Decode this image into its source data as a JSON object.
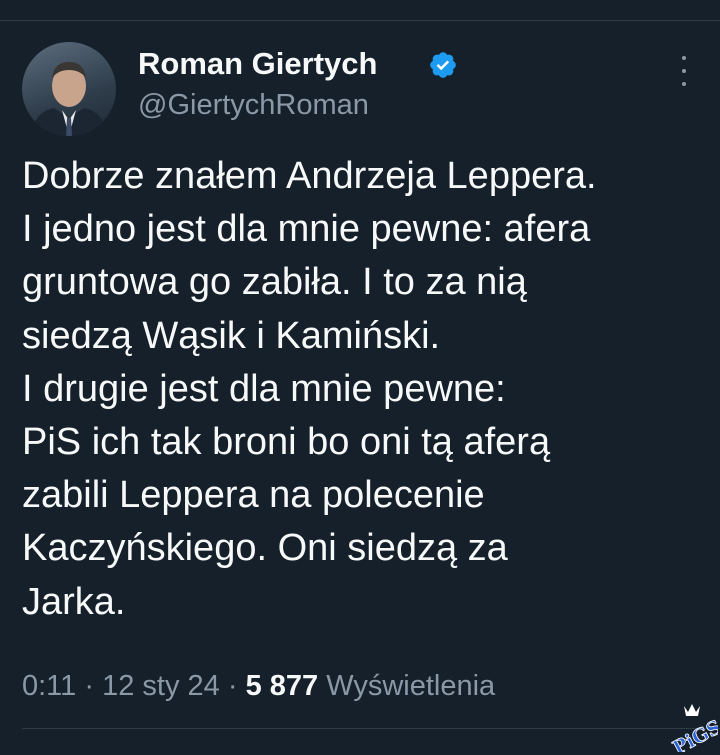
{
  "tweet": {
    "author": {
      "display_name": "Roman Giertych",
      "handle": "@GiertychRoman",
      "verified": true
    },
    "text_lines": [
      "Dobrze znałem Andrzeja Leppera.",
      "I jedno jest dla mnie pewne: afera",
      "gruntowa go zabiła. I to za nią",
      "siedzą Wąsik i Kamiński.",
      "I drugie jest dla mnie pewne:",
      "PiS ich tak broni bo oni tą aferą",
      "zabili Leppera na polecenie",
      "Kaczyńskiego. Oni siedzą za",
      "Jarka."
    ],
    "meta": {
      "time": "0:11",
      "separator": "·",
      "date": "12 sty 24",
      "views_count": "5 877",
      "views_label": "Wyświetlenia"
    }
  },
  "watermark": {
    "text": "PiGS"
  },
  "colors": {
    "background": "#15202b",
    "primary_text": "#f7f9f9",
    "secondary_text": "#8b98a5",
    "verified_blue": "#1d9bf0",
    "divider": "#2f3b47"
  },
  "icons": {
    "verified": "verified-badge-icon",
    "more": "more-options-icon"
  }
}
